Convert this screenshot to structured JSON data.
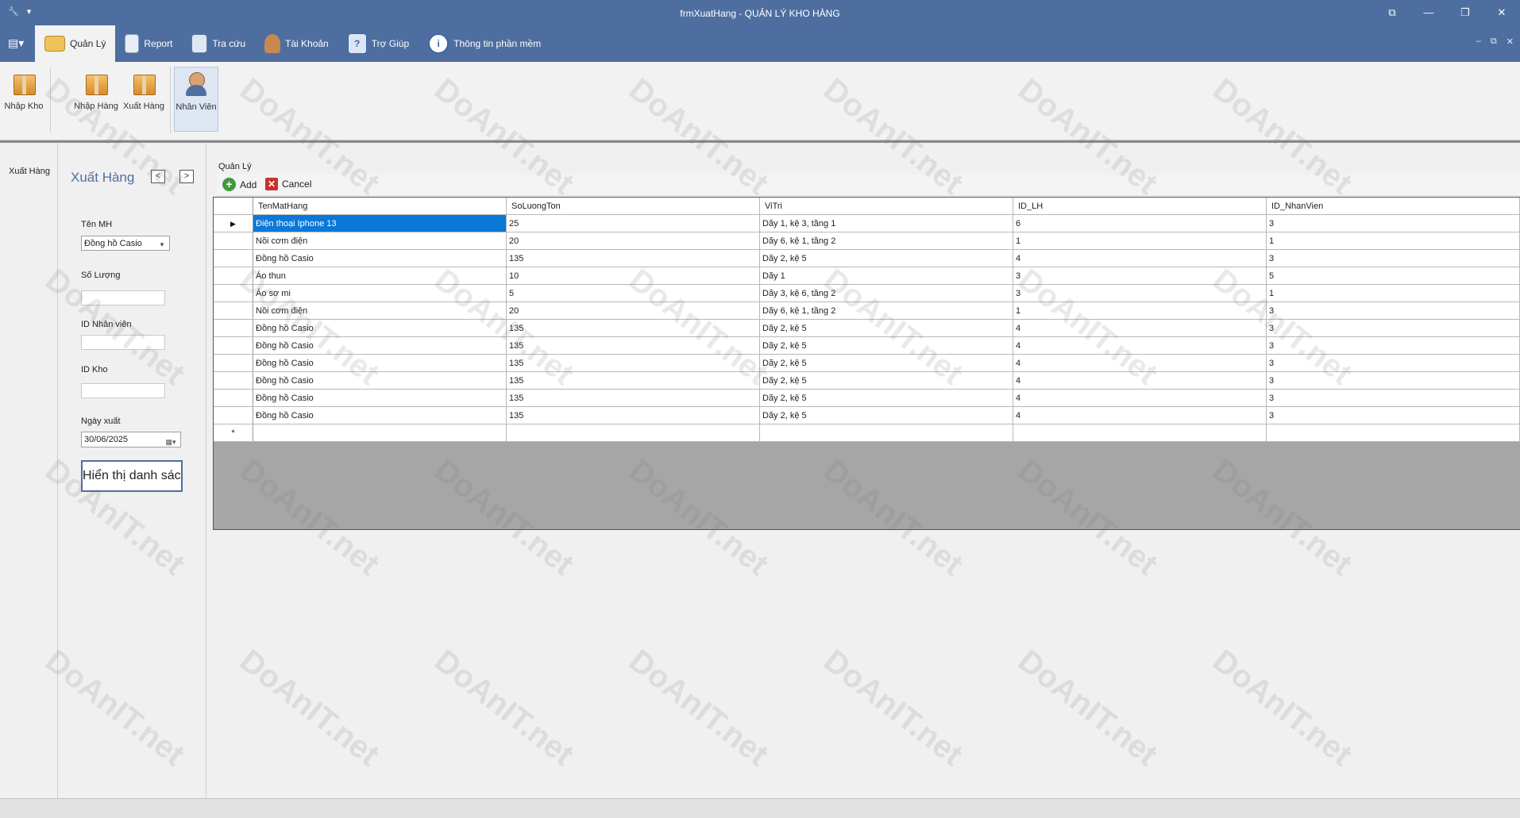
{
  "window": {
    "title": "frmXuatHang - QUẢN LÝ KHO HÀNG",
    "controls": [
      "⧉",
      "—",
      "❐",
      "✕"
    ],
    "mdi_controls": [
      "–",
      "⧉",
      "✕"
    ]
  },
  "ribbon": {
    "tabs": [
      {
        "label": "Quản Lý",
        "icon": "folder-search-icon",
        "active": true
      },
      {
        "label": "Report",
        "icon": "clipboard-icon"
      },
      {
        "label": "Tra cứu",
        "icon": "search-document-icon"
      },
      {
        "label": "Tài Khoản",
        "icon": "user-account-icon"
      },
      {
        "label": "Trợ Giúp",
        "icon": "help-icon"
      },
      {
        "label": "Thông tin phần mềm",
        "icon": "info-icon"
      }
    ],
    "buttons": [
      {
        "label": "Nhập Kho",
        "icon": "warehouse-box-icon"
      },
      {
        "label": "Nhập Hàng",
        "icon": "import-boxes-icon"
      },
      {
        "label": "Xuất Hàng",
        "icon": "export-box-icon"
      },
      {
        "label": "Nhân Viên",
        "icon": "employees-icon",
        "active": true
      }
    ]
  },
  "nav": {
    "item": "Xuất Hàng"
  },
  "form": {
    "title": "Xuất Hàng",
    "prev": "<",
    "next": ">",
    "ten_mh_label": "Tên MH",
    "ten_mh_value": "Đồng hồ Casio",
    "so_luong_label": "Số Lượng",
    "so_luong_value": "",
    "id_nhan_vien_label": "ID Nhân viên",
    "id_nhan_vien_value": "",
    "id_kho_label": "ID Kho",
    "id_kho_value": "",
    "ngay_xuat_label": "Ngày xuất",
    "ngay_xuat_value": "30/06/2025",
    "show_button": "Hiển thị danh sách"
  },
  "main": {
    "group_label": "Quản Lý",
    "toolbar": {
      "add": "Add",
      "cancel": "Cancel"
    }
  },
  "grid": {
    "columns": [
      "TenMatHang",
      "SoLuongTon",
      "ViTri",
      "ID_LH",
      "ID_NhanVien"
    ],
    "rows": [
      [
        "Điện thoại Iphone 13",
        "25",
        "Dãy 1, kệ 3, tầng 1",
        "6",
        "3"
      ],
      [
        "Nồi cơm điện",
        "20",
        "Dãy 6, kệ 1, tầng 2",
        "1",
        "1"
      ],
      [
        "Đồng hồ Casio",
        "135",
        "Dãy 2, kệ 5",
        "4",
        "3"
      ],
      [
        "Áo thun",
        "10",
        "Dãy 1",
        "3",
        "5"
      ],
      [
        "Áo sơ mi",
        "5",
        "Dãy 3, kệ 6, tầng 2",
        "3",
        "1"
      ],
      [
        "Nồi cơm điện",
        "20",
        "Dãy 6, kệ 1, tầng 2",
        "1",
        "3"
      ],
      [
        "Đồng hồ Casio",
        "135",
        "Dãy 2, kệ 5",
        "4",
        "3"
      ],
      [
        "Đồng hồ Casio",
        "135",
        "Dãy 2, kệ 5",
        "4",
        "3"
      ],
      [
        "Đồng hồ Casio",
        "135",
        "Dãy 2, kệ 5",
        "4",
        "3"
      ],
      [
        "Đồng hồ Casio",
        "135",
        "Dãy 2, kệ 5",
        "4",
        "3"
      ],
      [
        "Đồng hồ Casio",
        "135",
        "Dãy 2, kệ 5",
        "4",
        "3"
      ],
      [
        "Đồng hồ Casio",
        "135",
        "Dãy 2, kệ 5",
        "4",
        "3"
      ]
    ],
    "selected_row": 0,
    "current_marker": "▶",
    "new_row_marker": "*"
  },
  "watermark": "DoAnIT.net",
  "colors": {
    "titlebar": "#4e6ea0",
    "selection": "#0a78d7",
    "accent_text": "#4f6fa6"
  }
}
